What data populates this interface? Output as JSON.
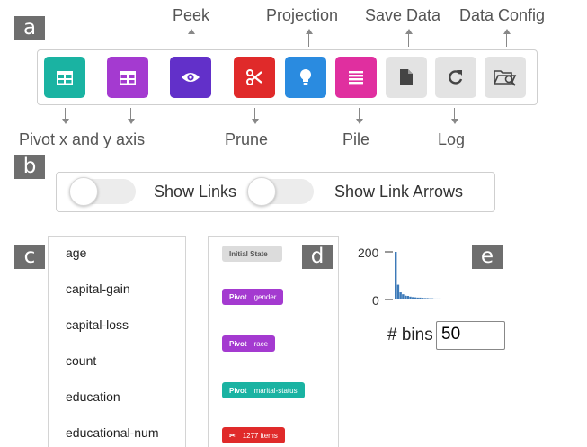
{
  "panels": {
    "a": "a",
    "b": "b",
    "c": "c",
    "d": "d",
    "e": "e"
  },
  "callouts": {
    "peek": "Peek",
    "projection": "Projection",
    "save_data": "Save Data",
    "data_config": "Data Config",
    "pivot": "Pivot x and y axis",
    "prune": "Prune",
    "pile": "Pile",
    "log": "Log"
  },
  "toolbar": {
    "colors": {
      "pivot_x": "#1ab3a2",
      "pivot_y": "#a43ad0",
      "peek": "#6230c9",
      "prune": "#e02a2a",
      "projection": "#2a8be0",
      "pile": "#e02f9f",
      "inactive": "#e3e3e3"
    },
    "icons": [
      "pivot-x-icon",
      "pivot-y-icon",
      "eye-icon",
      "scissors-icon",
      "lightbulb-icon",
      "list-icon",
      "file-icon",
      "redo-icon",
      "folder-search-icon"
    ]
  },
  "links": {
    "show_links": "Show Links",
    "show_link_arrows": "Show Link Arrows"
  },
  "attributes": [
    "age",
    "capital-gain",
    "capital-loss",
    "count",
    "education",
    "educational-num"
  ],
  "history": [
    {
      "key": "Initial State",
      "value": "",
      "color": "#dcdcdc"
    },
    {
      "key": "Pivot",
      "value": "gender",
      "color": "#a43ad0"
    },
    {
      "key": "Pivot",
      "value": "race",
      "color": "#a43ad0"
    },
    {
      "key": "Pivot",
      "value": "marital-status",
      "color": "#1ab3a2"
    },
    {
      "key": "✂",
      "value": "1277 items",
      "color": "#e02a2a"
    }
  ],
  "histogram": {
    "y_ticks": [
      "200",
      "0"
    ],
    "bins_label": "# bins",
    "bins_value": "50",
    "bar_color": "#3d7ab8"
  },
  "chart_data": {
    "type": "bar",
    "ylim": [
      0,
      200
    ],
    "values": [
      200,
      62,
      30,
      22,
      16,
      15,
      12,
      10,
      9,
      8,
      8,
      7,
      6,
      6,
      5,
      5,
      4,
      4,
      4,
      3,
      3,
      3,
      3,
      2,
      2,
      2,
      2,
      2,
      2,
      2,
      1,
      1,
      1,
      1,
      1,
      1,
      1,
      1,
      1,
      1,
      1,
      1,
      1,
      1,
      1,
      1,
      1,
      1,
      1,
      1
    ]
  }
}
